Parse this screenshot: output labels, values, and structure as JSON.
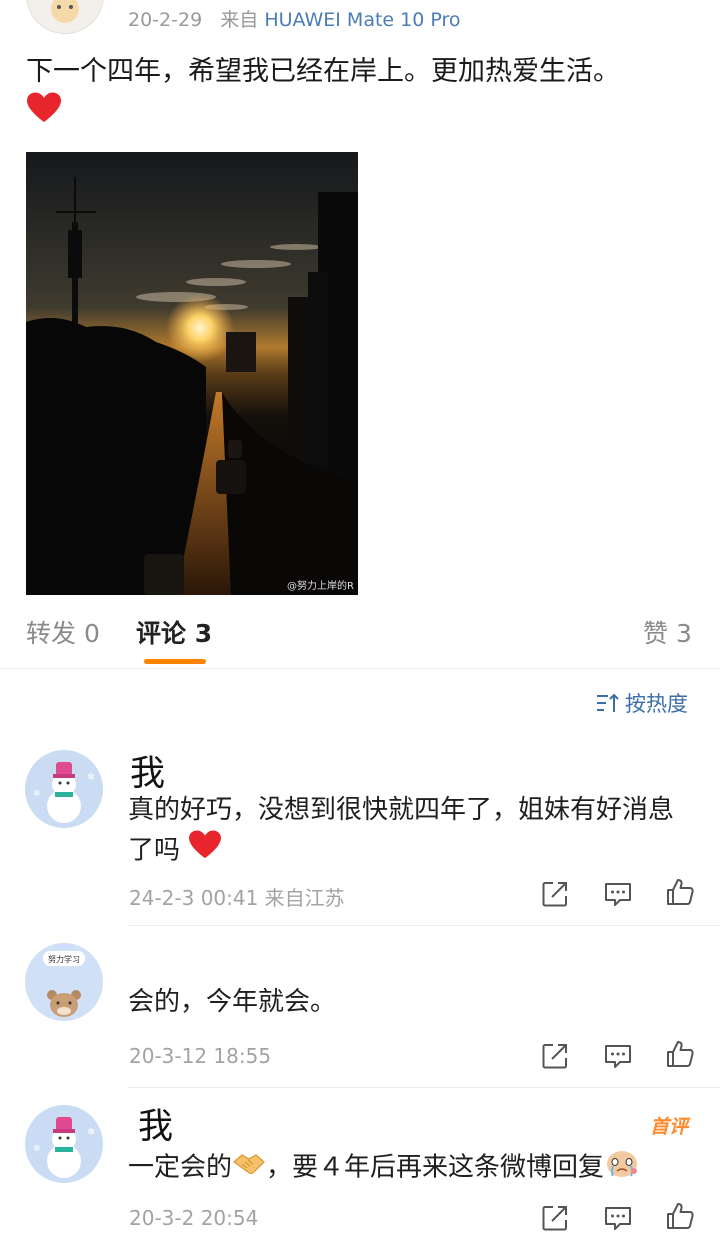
{
  "post": {
    "date": "20-2-29",
    "source_prefix": "来自",
    "device": "HUAWEI Mate 10 Pro",
    "text": "下一个四年，希望我已经在岸上。更加热爱生活。",
    "image_watermark": "@努力上岸的R"
  },
  "tabs": {
    "repost": "转发 0",
    "comments": "评论 3",
    "likes": "赞 3"
  },
  "sort": {
    "label": "按热度"
  },
  "comments": [
    {
      "name": "我",
      "text": "真的好巧，没想到很快就四年了，姐妹有好消息了吗",
      "meta": "24-2-3 00:41  来自江苏"
    },
    {
      "name": "",
      "avatar_text": "努力学习",
      "text": "会的，今年就会。",
      "meta": "20-3-12 18:55"
    },
    {
      "name": "我",
      "badge": "首评",
      "text_a": "一定会的",
      "text_b": "，要４年后再来这条微博回复",
      "meta": "20-3-2 20:54"
    }
  ],
  "colors": {
    "accent_orange": "#ff8200",
    "link_blue": "#4a7db5",
    "heart_red": "#e8242c"
  }
}
